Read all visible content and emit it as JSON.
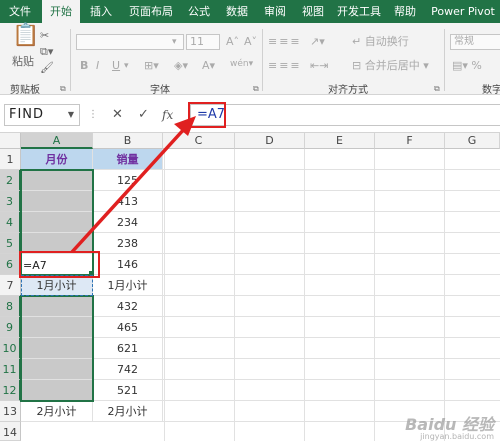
{
  "tabs": [
    "文件",
    "开始",
    "插入",
    "页面布局",
    "公式",
    "数据",
    "审阅",
    "视图",
    "开发工具",
    "帮助",
    "Power Pivot"
  ],
  "active_tab_index": 1,
  "ribbon": {
    "clipboard": {
      "paste_label": "粘贴",
      "group_label": "剪贴板"
    },
    "font": {
      "size_value": "11",
      "bold": "B",
      "italic": "I",
      "underline": "U",
      "grow": "A",
      "shrink": "A",
      "font_color": "A",
      "phonetic": "wén",
      "group_label": "字体"
    },
    "alignment": {
      "wrap_label": "自动换行",
      "merge_label": "合并后居中",
      "group_label": "对齐方式"
    },
    "number": {
      "format_value": "常规",
      "group_label": "数字"
    }
  },
  "formula_bar": {
    "name_box": "FIND",
    "cancel": "✕",
    "enter": "✓",
    "fx": "fx",
    "formula": "=A7"
  },
  "columns": [
    "A",
    "B",
    "C",
    "D",
    "E",
    "F",
    "G"
  ],
  "rows": [
    "1",
    "2",
    "3",
    "4",
    "5",
    "6",
    "7",
    "8",
    "9",
    "10",
    "11",
    "12",
    "13",
    "14"
  ],
  "cells": {
    "A1": "月份",
    "B1": "销量",
    "B2": "125",
    "B3": "413",
    "B4": "234",
    "B5": "238",
    "A6": "=A7",
    "B6": "146",
    "A7": "1月小计",
    "B7": "1月小计",
    "B8": "432",
    "B9": "465",
    "B10": "621",
    "B11": "742",
    "B12": "521",
    "A13": "2月小计",
    "B13": "2月小计"
  },
  "watermark": {
    "brand": "Baidu 经验",
    "url": "jingyan.baidu.com"
  },
  "colors": {
    "excel_green": "#217346",
    "header_fill": "#bdd7ee",
    "header_text": "#7030a0",
    "gray_fill": "#c9c9c9",
    "annotation_red": "#e02020"
  }
}
